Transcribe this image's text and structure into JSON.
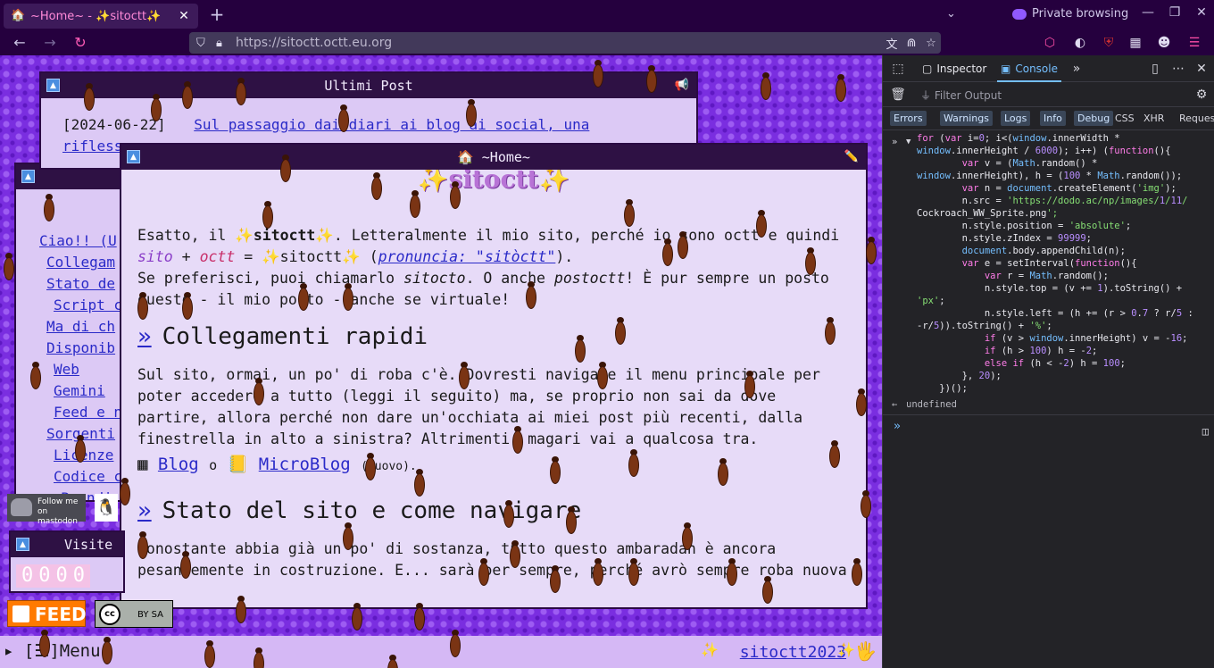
{
  "browser": {
    "tab": {
      "favicon": "🏠",
      "title": "~Home~ - ✨sitoctt✨",
      "close": "✕"
    },
    "new_tab": "+",
    "tab_list": "⌄",
    "private_label": "Private browsing",
    "window_controls": [
      "—",
      "❐",
      "✕"
    ],
    "url": "https://sitoctt.octt.eu.org",
    "nav_back": "←",
    "nav_forward": "→",
    "nav_reload": "↻"
  },
  "page": {
    "nav_window": {
      "items": [
        "Ciao!! (U",
        "Collegam",
        "Stato de",
        "Script c",
        "Ma di ch",
        "Disponib",
        "Web",
        "Gemini",
        "Feed e n",
        "Sorgenti",
        "Licenze",
        "Codice c",
        "Prendi"
      ]
    },
    "posts_window": {
      "title": "Ultimi Post",
      "date": "[2024-06-22]",
      "link": "Sul passaggio dai diari ai blog ai social, una",
      "link_cont": "rifless"
    },
    "home_window": {
      "title": "🏠 ~Home~",
      "banner": "✨sitoctt✨",
      "p1_a": "Esatto, il ",
      "p1_b": "sitoctt",
      "p1_c": ". Letteralmente il mio sito, perché io sono octt e quindi",
      "p1_d": "sito",
      "p1_e": " + ",
      "p1_f": "octt",
      "p1_g": " = ",
      "p1_h": "sitoctt",
      "p1_i": " (",
      "p1_j": "pronuncia: \"sitòctt\"",
      "p1_k": ").",
      "p2_a": "Se preferisci, puoi chiamarlo ",
      "p2_b": "sitocto",
      "p2_c": ". O anche ",
      "p2_d": "postoctt",
      "p2_e": "! È pur sempre un posto",
      "p2_f": "questo - il mio posto - anche se virtuale!",
      "h_links": "Collegamenti rapidi",
      "p3": "Sul sito, ormai, un po' di roba c'è. Dovresti navigare il menu principale per poter accedere a tutto (leggi il seguito) ma, se proprio non sai da dove partire, allora perché non dare un'occhiata ai miei post più recenti, dalla finestrella in alto a sinistra? Altrimenti, magari vai a qualcosa tra.",
      "blog_icon": "▦",
      "blog": "Blog",
      "or": "o",
      "micro_icon": "📒",
      "microblog": "MicroBlog",
      "micro_note": "(nuovo).",
      "h_stato": "Stato del sito e come navigare",
      "p4": "Nonostante abbia già un po' di sostanza, tutto questo ambaradan è ancora pesantemente in costruzione. E... sarà per sempre, perché avrò sempre roba nuova"
    },
    "badges": {
      "mastodon": "Follow me on mastodon",
      "visite_title": "Visite",
      "counter": [
        "0",
        "0",
        "0",
        "0"
      ],
      "feed": "FEED",
      "cc": "BY SA"
    },
    "taskbar": {
      "menu": "▸ [☰]Menu",
      "copyright": "sitoctt2023",
      "spark": "✨",
      "hand": "🖐"
    }
  },
  "devtools": {
    "tabs": [
      "Inspector",
      "Console"
    ],
    "filter_placeholder": "Filter Output",
    "levels": [
      "Errors",
      "Warnings",
      "Logs",
      "Info",
      "Debug"
    ],
    "types": [
      "CSS",
      "XHR",
      "Requests"
    ],
    "code": [
      "for (var i=0; i<(window.innerWidth *",
      "window.innerHeight / 6000); i++) (function(){",
      "        var v = (Math.random() *",
      "window.innerHeight), h = (100 * Math.random());",
      "        var n = document.createElement('img');",
      "        n.src = 'https://dodo.ac/np/images/1/11/",
      "Cockroach_WW_Sprite.png';",
      "        n.style.position = 'absolute';",
      "        n.style.zIndex = 99999;",
      "        document.body.appendChild(n);",
      "        var e = setInterval(function(){",
      "            var r = Math.random();",
      "            n.style.top = (v += 1).toString() +",
      "'px';",
      "            n.style.left = (h += (r > 0.7 ? r/5 :",
      "-r/5)).toString() + '%';",
      "            if (v > window.innerHeight) v = -16;",
      "            if (h > 100) h = -2;",
      "            else if (h < -2) h = 100;",
      "        }, 20);",
      "    })();"
    ],
    "result": "undefined",
    "prompt": "»"
  }
}
